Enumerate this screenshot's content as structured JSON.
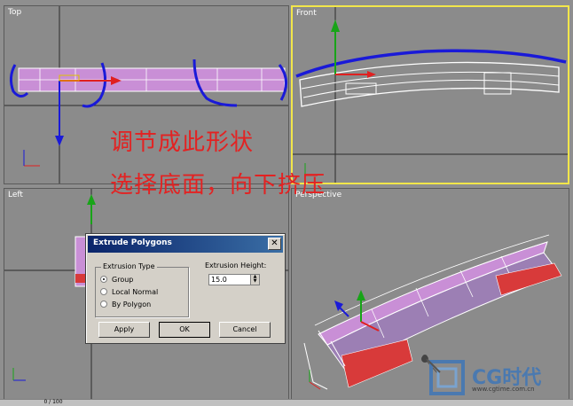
{
  "viewports": {
    "top": {
      "label": "Top"
    },
    "front": {
      "label": "Front"
    },
    "left": {
      "label": "Left"
    },
    "perspective": {
      "label": "Perspective"
    }
  },
  "annotation": {
    "line1": "调节成此形状",
    "line2": "选择底面，向下挤压"
  },
  "dialog": {
    "title": "Extrude Polygons",
    "close_glyph": "✕",
    "group_label": "Extrusion Type",
    "options": [
      "Group",
      "Local Normal",
      "By Polygon"
    ],
    "selected_option": "Group",
    "height_label": "Extrusion Height:",
    "height_value": "15.0",
    "apply_label": "Apply",
    "ok_label": "OK",
    "cancel_label": "Cancel"
  },
  "timeline": {
    "frame_text": "0 / 100"
  },
  "logo": {
    "brand": "CG时代",
    "url": "www.cgtime.com.cn"
  },
  "colors": {
    "viewport_bg": "#8b8b8b",
    "active_border": "#f2e64a",
    "selection_mesh": "#c98fd6",
    "annotation_red": "#e32222",
    "stroke_blue": "#1a1ad8",
    "dialog_title": "#0a246a"
  },
  "icons": [
    "axis-gizmo-icon",
    "transform-gizmo-icon",
    "close-icon",
    "radio-icon",
    "spinner-arrows-icon",
    "cg-logo-icon"
  ]
}
